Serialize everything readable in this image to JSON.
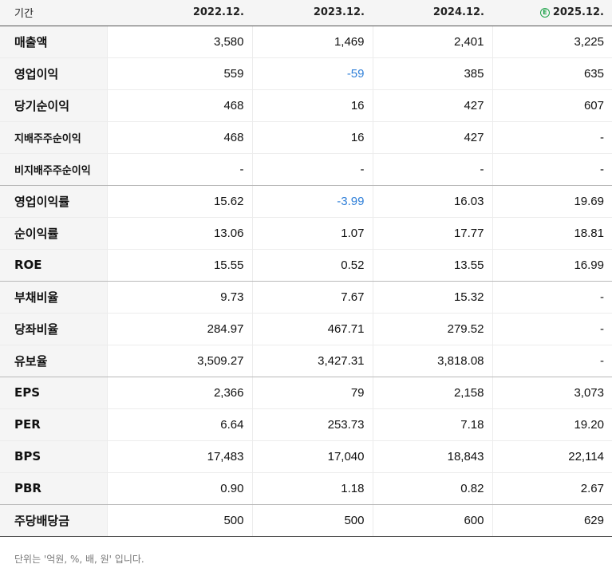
{
  "header": {
    "label": "기간",
    "periods": [
      "2022.12.",
      "2023.12.",
      "2024.12.",
      "2025.12."
    ],
    "estimate_badge": "E",
    "estimate_color": "#1fa34a"
  },
  "rows": [
    {
      "label": "매출액",
      "values": [
        "3,580",
        "1,469",
        "2,401",
        "3,225"
      ]
    },
    {
      "label": "영업이익",
      "values": [
        "559",
        "-59",
        "385",
        "635"
      ]
    },
    {
      "label": "당기순이익",
      "values": [
        "468",
        "16",
        "427",
        "607"
      ]
    },
    {
      "label": "지배주주순이익",
      "values": [
        "468",
        "16",
        "427",
        "-"
      ]
    },
    {
      "label": "비지배주주순이익",
      "values": [
        "-",
        "-",
        "-",
        "-"
      ]
    },
    {
      "label": "영업이익률",
      "values": [
        "15.62",
        "-3.99",
        "16.03",
        "19.69"
      ]
    },
    {
      "label": "순이익률",
      "values": [
        "13.06",
        "1.07",
        "17.77",
        "18.81"
      ]
    },
    {
      "label": "ROE",
      "values": [
        "15.55",
        "0.52",
        "13.55",
        "16.99"
      ]
    },
    {
      "label": "부채비율",
      "values": [
        "9.73",
        "7.67",
        "15.32",
        "-"
      ]
    },
    {
      "label": "당좌비율",
      "values": [
        "284.97",
        "467.71",
        "279.52",
        "-"
      ]
    },
    {
      "label": "유보율",
      "values": [
        "3,509.27",
        "3,427.31",
        "3,818.08",
        "-"
      ]
    },
    {
      "label": "EPS",
      "values": [
        "2,366",
        "79",
        "2,158",
        "3,073"
      ]
    },
    {
      "label": "PER",
      "values": [
        "6.64",
        "253.73",
        "7.18",
        "19.20"
      ]
    },
    {
      "label": "BPS",
      "values": [
        "17,483",
        "17,040",
        "18,843",
        "22,114"
      ]
    },
    {
      "label": "PBR",
      "values": [
        "0.90",
        "1.18",
        "0.82",
        "2.67"
      ]
    },
    {
      "label": "주당배당금",
      "values": [
        "500",
        "500",
        "600",
        "629"
      ]
    }
  ],
  "footnote": "단위는 '억원, %, 배, 원' 입니다.",
  "colors": {
    "negative": "#2f7fd8"
  }
}
